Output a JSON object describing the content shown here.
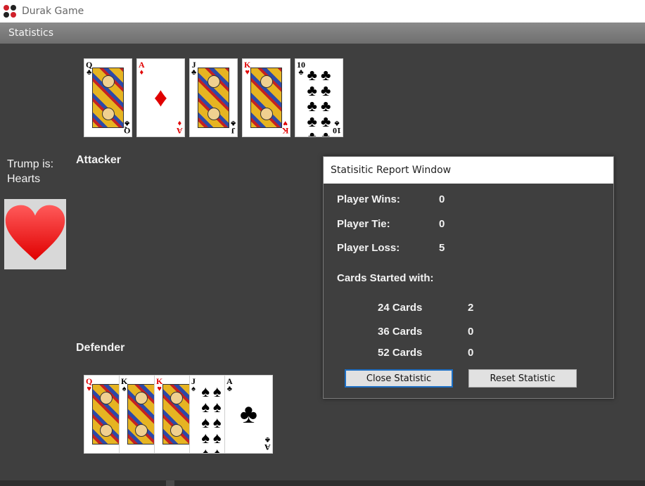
{
  "window": {
    "title": "Durak Game"
  },
  "menu": {
    "items": [
      "Statistics"
    ]
  },
  "attacker": {
    "label": "Attacker",
    "cards": [
      {
        "rank": "Q",
        "suit": "♣",
        "color": "black",
        "type": "face"
      },
      {
        "rank": "A",
        "suit": "♦",
        "color": "red",
        "type": "ace"
      },
      {
        "rank": "J",
        "suit": "♣",
        "color": "black",
        "type": "face"
      },
      {
        "rank": "K",
        "suit": "♥",
        "color": "red",
        "type": "face"
      },
      {
        "rank": "10",
        "suit": "♣",
        "color": "black",
        "type": "pips"
      }
    ]
  },
  "trump": {
    "line1": "Trump is:",
    "line2": "Hearts",
    "icon": "heart-icon",
    "color": "#ff2020"
  },
  "defender": {
    "label": "Defender",
    "cards": [
      {
        "rank": "Q",
        "suit": "♥",
        "color": "red",
        "type": "face"
      },
      {
        "rank": "K",
        "suit": "♠",
        "color": "black",
        "type": "face"
      },
      {
        "rank": "K",
        "suit": "♥",
        "color": "red",
        "type": "face"
      },
      {
        "rank": "J",
        "suit": "♠",
        "color": "black",
        "type": "pips"
      },
      {
        "rank": "A",
        "suit": "♣",
        "color": "black",
        "type": "ace"
      }
    ]
  },
  "report": {
    "title": "Statisitic Report Window",
    "wins_label": "Player Wins:",
    "wins_value": "0",
    "tie_label": "Player Tie:",
    "tie_value": "0",
    "loss_label": "Player Loss:",
    "loss_value": "5",
    "cards_heading": "Cards Started with:",
    "c24_label": "24 Cards",
    "c24_value": "2",
    "c36_label": "36 Cards",
    "c36_value": "0",
    "c52_label": "52 Cards",
    "c52_value": "0",
    "close_button": "Close Statistic",
    "reset_button": "Reset Statistic"
  }
}
